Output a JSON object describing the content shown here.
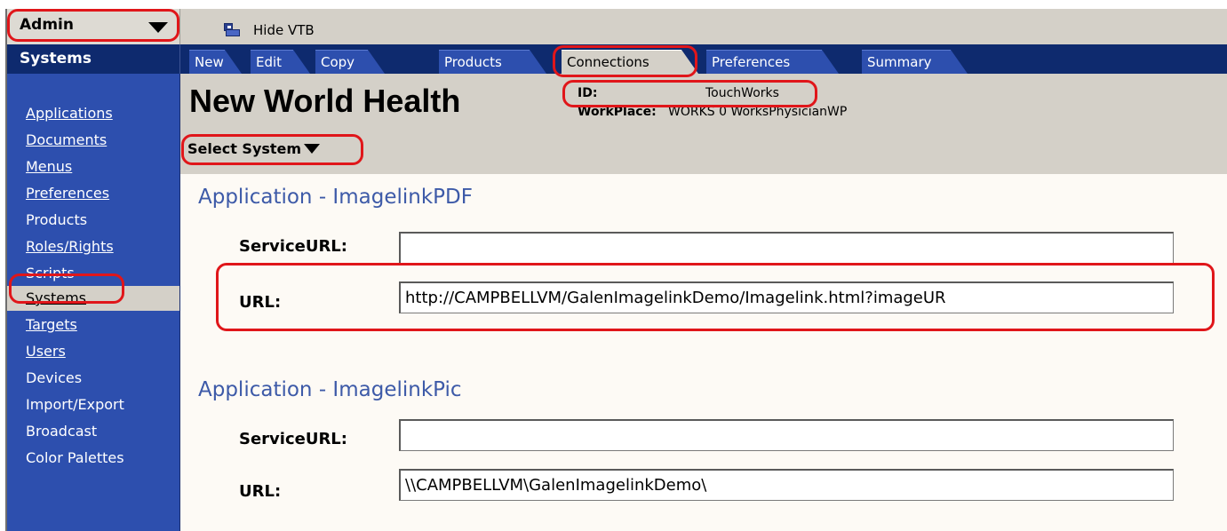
{
  "admin_menu": {
    "label": "Admin"
  },
  "toolbar": {
    "hide_vtb_label": "Hide VTB"
  },
  "sidebar": {
    "header": "Systems",
    "items": [
      "Applications",
      "Documents",
      "Menus",
      "Preferences",
      "Products",
      "Roles/Rights",
      "Scripts",
      "Systems",
      "Targets",
      "Users",
      "Devices",
      "Import/Export",
      "Broadcast",
      "Color Palettes"
    ],
    "selected": "Systems"
  },
  "tabs": [
    "New",
    "Edit",
    "Copy",
    "Products",
    "Connections",
    "Preferences",
    "Summary"
  ],
  "active_tab": "Connections",
  "system": {
    "title": "New World Health",
    "id_label": "ID:",
    "id_value": "TouchWorks",
    "workplace_label": "WorkPlace:",
    "workplace_value": "WORKS 0 WorksPhysicianWP",
    "select_label": "Select System"
  },
  "applications": [
    {
      "title": "Application - ImagelinkPDF",
      "service_url_label": "ServiceURL:",
      "service_url_value": "",
      "url_label": "URL:",
      "url_value": "http://CAMPBELLVM/GalenImagelinkDemo/Imagelink.html?imageUR"
    },
    {
      "title": "Application - ImagelinkPic",
      "service_url_label": "ServiceURL:",
      "service_url_value": "",
      "url_label": "URL:",
      "url_value": "\\\\CAMPBELLVM\\GalenImagelinkDemo\\"
    }
  ],
  "colors": {
    "navbar": "#0e2a6e",
    "sidebar": "#2d4fae",
    "panel": "#d4d0c8",
    "app_title": "#3d5aa8",
    "annotation": "#e0161a"
  }
}
